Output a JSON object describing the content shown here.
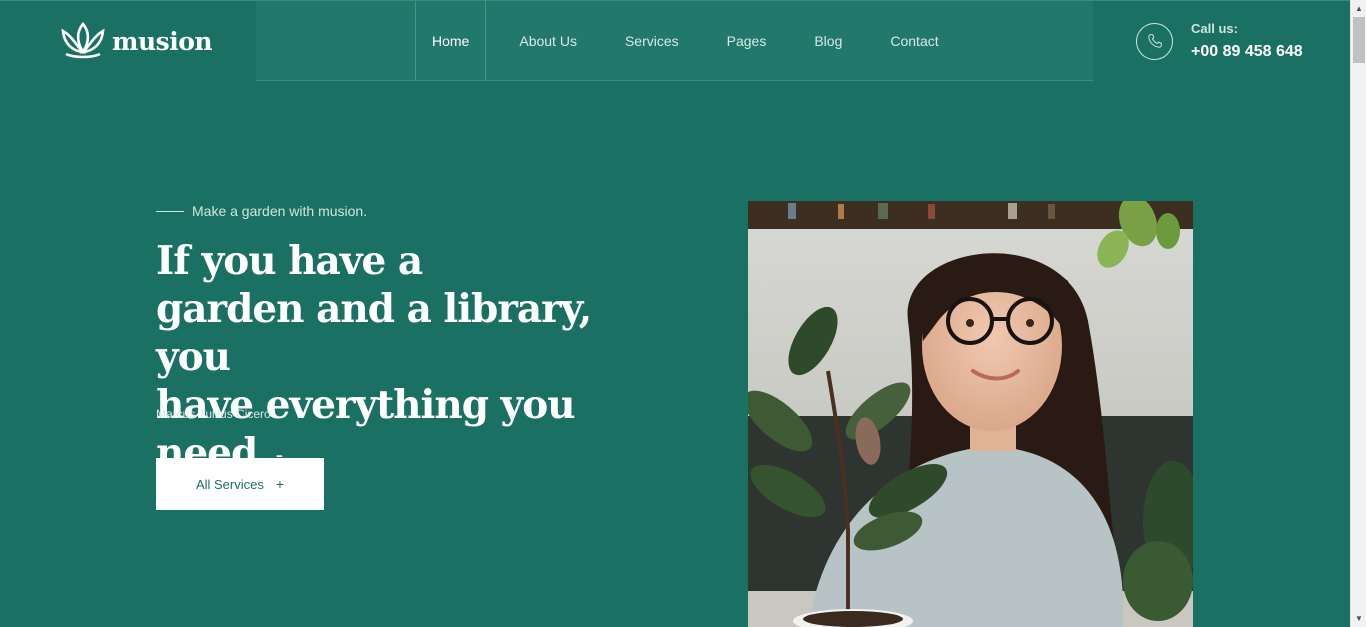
{
  "brand": {
    "name": "musion",
    "logo_icon": "lotus-icon"
  },
  "nav": {
    "items": [
      {
        "label": "Home",
        "active": true
      },
      {
        "label": "About Us"
      },
      {
        "label": "Services"
      },
      {
        "label": "Pages"
      },
      {
        "label": "Blog"
      },
      {
        "label": "Contact"
      }
    ]
  },
  "contact": {
    "label": "Call us:",
    "phone": "+00 89 458 648",
    "icon": "phone-icon"
  },
  "hero": {
    "tagline": "Make a garden with musion.",
    "headline_lines": [
      "If you have a",
      "garden and a library, you",
      "have everything you need."
    ],
    "headline_dash": "–",
    "author": "Marcus Tullius Cicero",
    "button_label": "All Services",
    "button_icon": "+"
  },
  "colors": {
    "primary": "#1a7163",
    "header": "#22786a",
    "white": "#ffffff"
  }
}
